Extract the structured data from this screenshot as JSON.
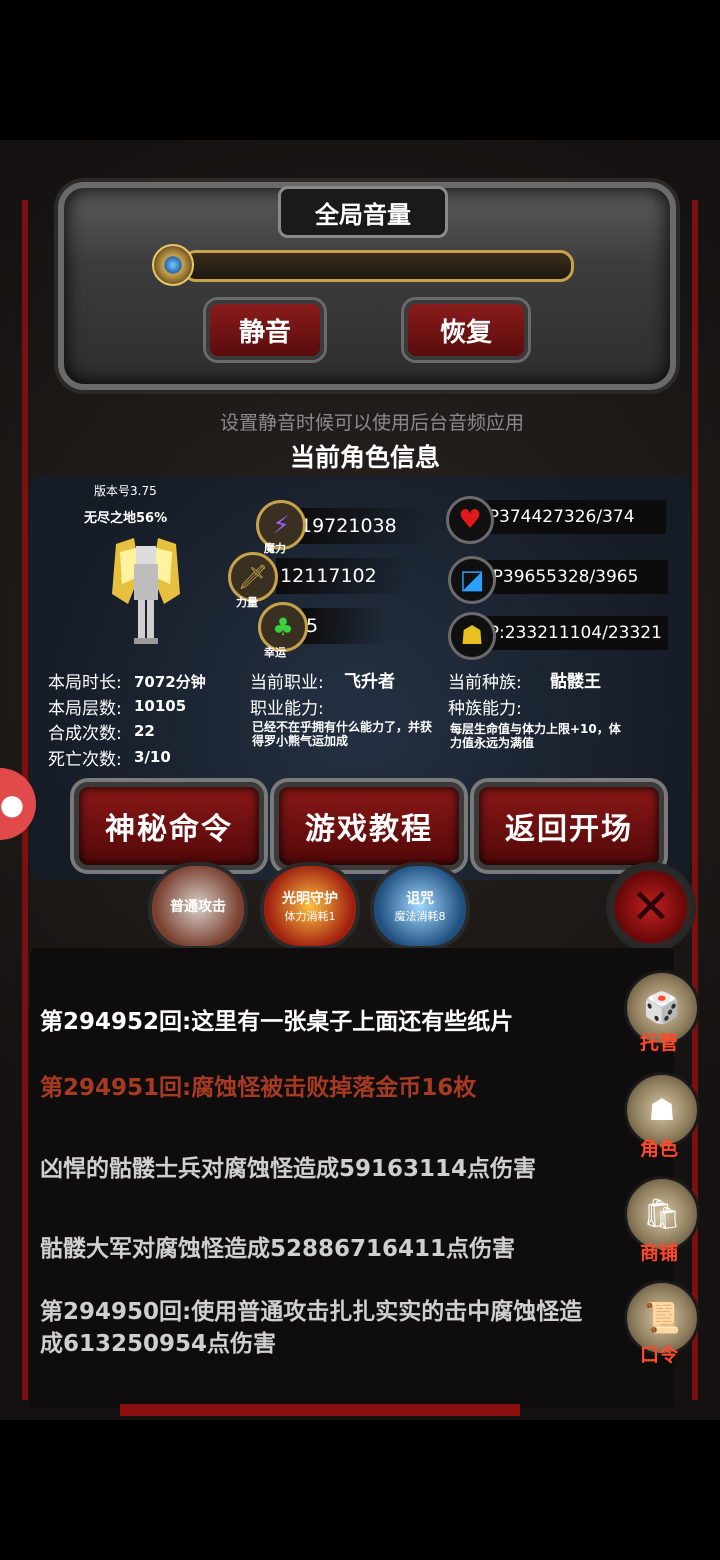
{
  "volume": {
    "title": "全局音量",
    "mute_label": "静音",
    "restore_label": "恢复",
    "hint": "设置静音时候可以使用后台音频应用"
  },
  "character": {
    "section_title": "当前角色信息",
    "version": "版本号3.75",
    "zone": "无尽之地56%",
    "magic": {
      "value": "19721038",
      "label": "魔力"
    },
    "power": {
      "value": "12117102",
      "label": "力量"
    },
    "luck": {
      "value": "5",
      "label": "幸运"
    },
    "hp": "HP374427326/374",
    "mp": "MP39655328/3965",
    "sp": "SP:233211104/23321",
    "stats": {
      "time_label": "本局时长:",
      "time_value": "7072分钟",
      "floors_label": "本局层数:",
      "floors_value": "10105",
      "craft_label": "合成次数:",
      "craft_value": "22",
      "death_label": "死亡次数:",
      "death_value": "3/10"
    },
    "job": {
      "label": "当前职业:",
      "value": "飞升者",
      "ability_label": "职业能力:",
      "ability_text": "已经不在乎拥有什么能力了，并获得罗小熊气运加成"
    },
    "race": {
      "label": "当前种族:",
      "value": "骷髅王",
      "ability_label": "种族能力:",
      "ability_text": "每层生命值与体力上限+10，体力值永远为满值"
    }
  },
  "actions": {
    "secret_cmd": "神秘命令",
    "tutorial": "游戏教程",
    "back": "返回开场"
  },
  "skills": [
    {
      "name": "普通攻击",
      "cost": ""
    },
    {
      "name": "光明守护",
      "cost": "体力消耗1"
    },
    {
      "name": "诅咒",
      "cost": "魔法消耗8"
    }
  ],
  "log": [
    {
      "text": "第294952回:这里有一张桌子上面还有些纸片",
      "color": "#ffffff"
    },
    {
      "text": "第294951回:腐蚀怪被击败掉落金币16枚",
      "color": "#a83a22"
    },
    {
      "text": "凶悍的骷髅士兵对腐蚀怪造成59163114点伤害",
      "color": "#cfcfcf"
    },
    {
      "text": "骷髅大军对腐蚀怪造成52886716411点伤害",
      "color": "#cfcfcf"
    },
    {
      "text": "第294950回:使用普通攻击扎扎实实的击中腐蚀怪造成613250954点伤害",
      "color": "#cfcfcf"
    }
  ],
  "side_menu": [
    {
      "label": "托管",
      "icon": "dice-icon"
    },
    {
      "label": "角色",
      "icon": "hooded-figure-icon"
    },
    {
      "label": "商铺",
      "icon": "shop-icon"
    },
    {
      "label": "口令",
      "icon": "scroll-icon"
    }
  ]
}
